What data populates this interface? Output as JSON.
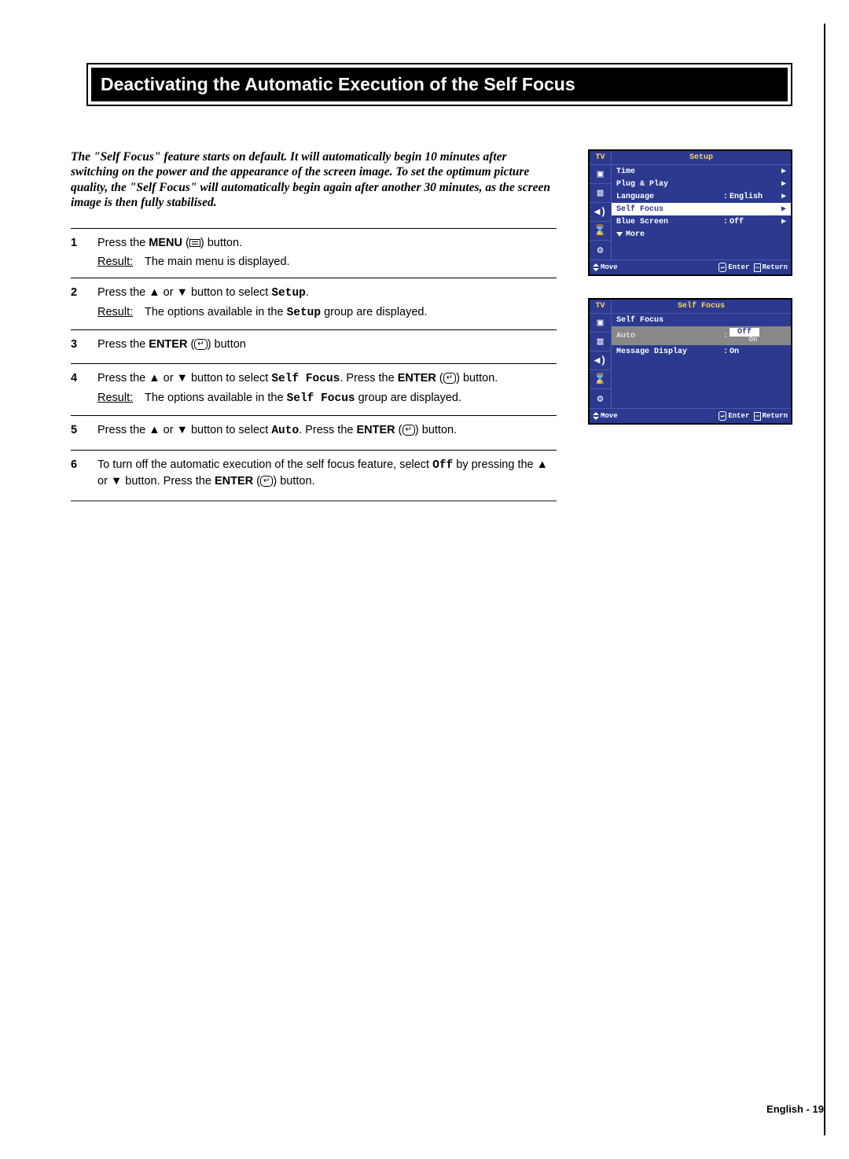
{
  "title": "Deactivating the Automatic Execution of the Self Focus",
  "intro": "The \"Self Focus\" feature starts on default.  It will automatically begin 10 minutes after switching on the power and the appearance of the screen image. To set the optimum picture quality, the \"Self Focus\" will automatically begin again after another 30 minutes, as the screen image is then fully stabilised.",
  "steps": [
    {
      "num": "1",
      "text_pre": "Press the ",
      "bold1": "MENU",
      "text_post": " button.",
      "result": "The main menu is displayed."
    },
    {
      "num": "2",
      "text": "Press the ▲ or ▼ button to select ",
      "mono1": "Setup",
      "text_end": ".",
      "result_pre": "The options available in the ",
      "result_mono": "Setup",
      "result_post": " group are displayed."
    },
    {
      "num": "3",
      "text_pre": "Press the ",
      "bold1": "ENTER",
      "text_post": " button"
    },
    {
      "num": "4",
      "line1_pre": "Press the ▲ or ▼ button to select ",
      "line1_mono": "Self Focus",
      "line1_mid": ". Press the ",
      "line1_bold": "ENTER",
      "line2": " button.",
      "result_pre": "The options available in the ",
      "result_mono": "Self Focus",
      "result_post": " group are displayed."
    },
    {
      "num": "5",
      "line1_pre": "Press the ▲ or ▼ button to select ",
      "line1_mono": "Auto",
      "line1_mid": ". Press the ",
      "line1_bold": "ENTER",
      "line2": " button."
    },
    {
      "num": "6",
      "line1": "To turn off the automatic execution of the self focus feature, select ",
      "line_mono": "Off",
      "line_mid": " by pressing the ▲ or ▼ button. Press the ",
      "line_bold": "ENTER",
      "line_end": " button."
    }
  ],
  "osd1": {
    "tv": "TV",
    "title": "Setup",
    "rows": [
      {
        "label": "Time",
        "arrow": "▶"
      },
      {
        "label": "Plug & Play",
        "arrow": "▶"
      },
      {
        "label": "Language",
        "colon": ":",
        "value": "English",
        "arrow": "▶"
      },
      {
        "label": "Self Focus",
        "arrow": "▶",
        "selected": true
      },
      {
        "label": "Blue Screen",
        "colon": ":",
        "value": "Off",
        "arrow": "▶"
      },
      {
        "label": "More",
        "more": true
      }
    ],
    "footer": {
      "move": "Move",
      "enter": "Enter",
      "return": "Return"
    }
  },
  "osd2": {
    "tv": "TV",
    "title": "Self Focus",
    "rows": [
      {
        "label": "Self Focus"
      },
      {
        "label": "Auto",
        "colon": ":",
        "value": "Off",
        "on_under": "On",
        "auto_highlight": true
      },
      {
        "label": "Message Display",
        "colon": ":",
        "value": "On"
      }
    ],
    "footer": {
      "move": "Move",
      "enter": "Enter",
      "return": "Return"
    }
  },
  "result_label": "Result:",
  "page_footer": "English - 19"
}
